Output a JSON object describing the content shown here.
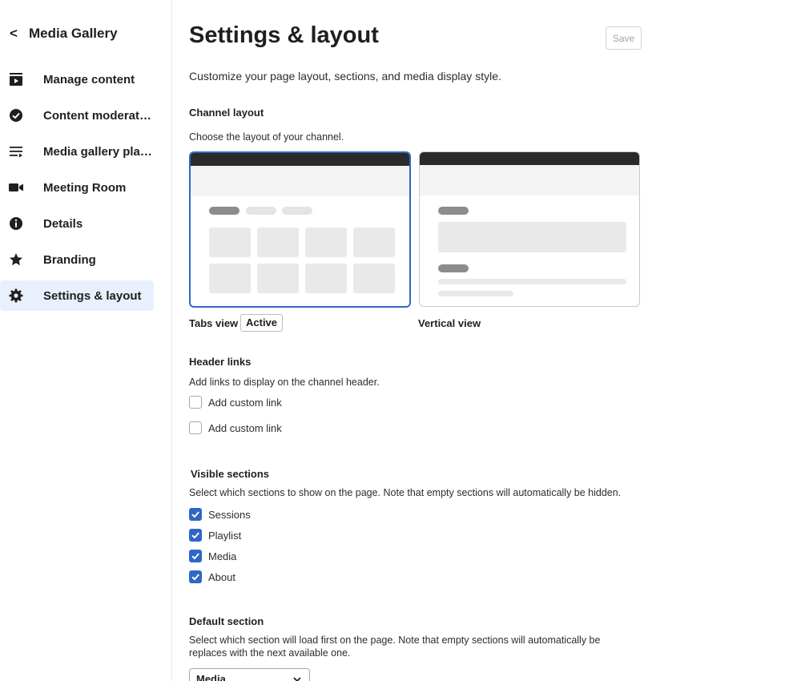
{
  "sidebar": {
    "back_label": "Media Gallery",
    "items": [
      {
        "label": "Manage content",
        "icon": "play-window-icon"
      },
      {
        "label": "Content moderation",
        "icon": "check-circle-icon"
      },
      {
        "label": "Media gallery play…",
        "icon": "playlist-icon"
      },
      {
        "label": "Meeting Room",
        "icon": "video-camera-icon"
      },
      {
        "label": "Details",
        "icon": "info-icon"
      },
      {
        "label": "Branding",
        "icon": "star-icon"
      },
      {
        "label": "Settings & layout",
        "icon": "gear-icon",
        "active": true
      }
    ]
  },
  "header": {
    "title": "Settings & layout",
    "save_label": "Save",
    "subtitle": "Customize your page layout, sections, and media display style."
  },
  "channel_layout": {
    "title": "Channel layout",
    "description": "Choose the layout of your channel.",
    "options": [
      {
        "label": "Tabs view",
        "badge": "Active",
        "selected": true
      },
      {
        "label": "Vertical view",
        "selected": false
      }
    ]
  },
  "header_links": {
    "title": "Header links",
    "description": "Add links to display on the channel header.",
    "links": [
      {
        "label": "Add custom link",
        "checked": false
      },
      {
        "label": "Add custom link",
        "checked": false
      }
    ]
  },
  "visible_sections": {
    "title": "Visible sections",
    "description": "Select which sections to show on the page. Note that empty sections will automatically be hidden.",
    "items": [
      {
        "label": "Sessions",
        "checked": true
      },
      {
        "label": "Playlist",
        "checked": true
      },
      {
        "label": "Media",
        "checked": true
      },
      {
        "label": "About",
        "checked": true
      }
    ]
  },
  "default_section": {
    "title": "Default section",
    "description_line1": "Select which section will load first on the page. Note that empty sections will automatically be",
    "description_line2": "replaces with the next available one.",
    "selected": "Media"
  },
  "colors": {
    "accent": "#2e67c6",
    "active_nav_bg": "#e8f0fe",
    "card_topbar": "#2a2a2a"
  }
}
